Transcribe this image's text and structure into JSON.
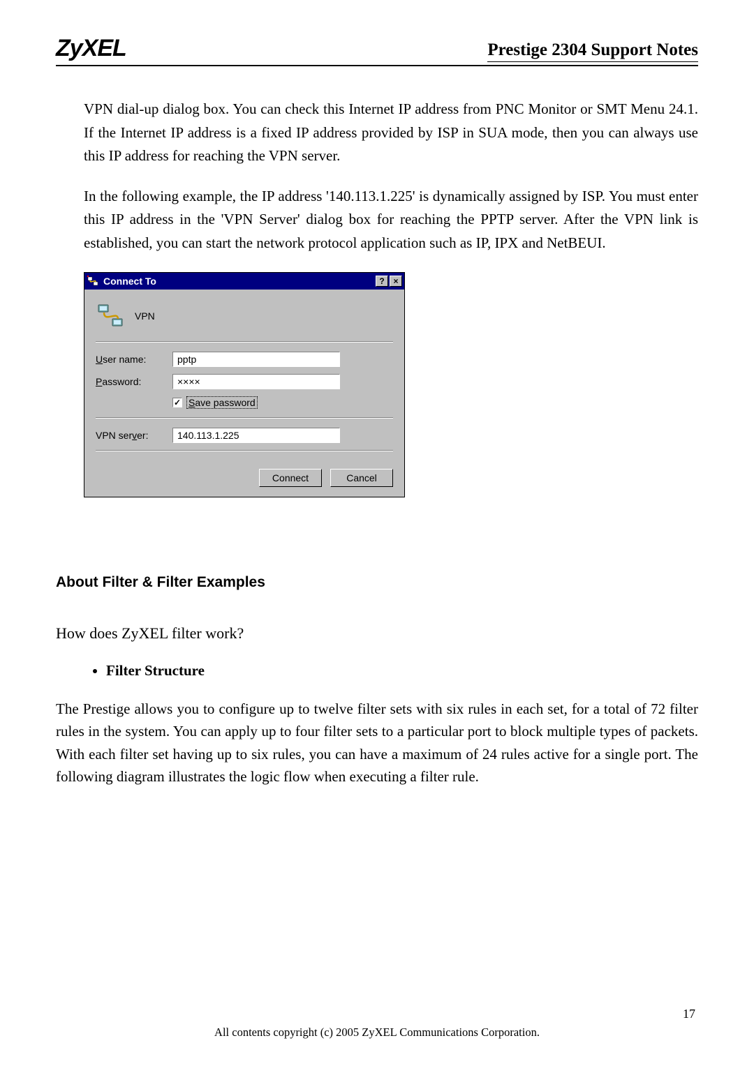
{
  "header": {
    "logo": "ZyXEL",
    "doc_title": "Prestige 2304 Support Notes"
  },
  "paragraphs": {
    "p1": "VPN dial-up dialog box. You can check this Internet IP address from PNC Monitor or SMT Menu 24.1. If the Internet IP address is a fixed IP address provided by ISP in SUA mode, then you can always use this IP address for reaching the VPN server.",
    "p2": "In the following example, the IP address '140.113.1.225' is dynamically assigned by ISP. You must enter this IP address in the 'VPN Server' dialog box for reaching the PPTP server. After the VPN link is established, you can start the network protocol application such as IP, IPX and NetBEUI."
  },
  "dialog": {
    "title": "Connect To",
    "help_glyph": "?",
    "close_glyph": "×",
    "vpn_label": "VPN",
    "username_label_pre": "U",
    "username_label_rest": "ser name:",
    "username_value": "pptp",
    "password_label_pre": "P",
    "password_label_rest": "assword:",
    "password_value": "××××",
    "save_pw_check": "✓",
    "save_pw_pre": "S",
    "save_pw_rest": "ave password",
    "vpnserver_label_pre": "VPN ser",
    "vpnserver_label_ul": "v",
    "vpnserver_label_post": "er:",
    "vpnserver_value": "140.113.1.225",
    "connect_btn": "Connect",
    "cancel_btn": "Cancel"
  },
  "sections": {
    "filter_heading": "About Filter & Filter Examples",
    "filter_q": "How does ZyXEL filter work?",
    "filter_bullet": "Filter Structure",
    "filter_para": "The Prestige allows you to configure up to twelve filter sets with six rules in each set, for a total of 72 filter rules in the system. You can apply up to four filter sets to a particular port to block multiple types of packets. With each filter set having up to six rules, you can have a maximum of 24 rules active for a single port. The following diagram illustrates the logic flow when executing a filter rule."
  },
  "footer": {
    "copyright": "All contents copyright (c) 2005 ZyXEL Communications Corporation.",
    "page": "17"
  }
}
